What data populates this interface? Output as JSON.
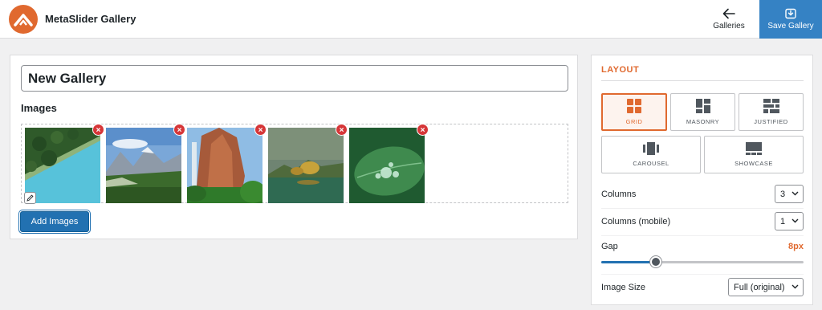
{
  "header": {
    "app_title": "MetaSlider Gallery",
    "galleries_label": "Galleries",
    "save_label": "Save Gallery",
    "save_button_color": "#3582c4",
    "logo_color": "#e0692f"
  },
  "main": {
    "gallery_title": "New Gallery",
    "images_heading": "Images",
    "images": [
      {
        "name": "aerial-forest-lake",
        "colors": [
          "#2f5a2a",
          "#57c2da"
        ]
      },
      {
        "name": "mountain-valley",
        "colors": [
          "#6a9ad0",
          "#3b6a2c"
        ]
      },
      {
        "name": "canyon-waterfall",
        "colors": [
          "#a65a3a",
          "#2f7a2a"
        ]
      },
      {
        "name": "misty-lake",
        "colors": [
          "#58705a",
          "#2f6a52"
        ]
      },
      {
        "name": "water-drops-leaf",
        "colors": [
          "#2a6a3a",
          "#8fd0a0"
        ]
      }
    ],
    "remove_icon_glyph": "×",
    "add_images_label": "Add Images"
  },
  "side": {
    "heading": "LAYOUT",
    "layouts": [
      {
        "label": "GRID",
        "icon": "grid-icon",
        "active": true
      },
      {
        "label": "MASONRY",
        "icon": "masonry-icon",
        "active": false
      },
      {
        "label": "JUSTIFIED",
        "icon": "justified-icon",
        "active": false
      },
      {
        "label": "CAROUSEL",
        "icon": "carousel-icon",
        "active": false
      },
      {
        "label": "SHOWCASE",
        "icon": "showcase-icon",
        "active": false
      }
    ],
    "columns_label": "Columns",
    "columns_value": "3",
    "columns_mobile_label": "Columns (mobile)",
    "columns_mobile_value": "1",
    "gap_label": "Gap",
    "gap_value": "8px",
    "gap_slider_fraction": 0.27,
    "image_size_label": "Image Size",
    "image_size_value": "Full (original)",
    "accent_color": "#e0692f"
  }
}
